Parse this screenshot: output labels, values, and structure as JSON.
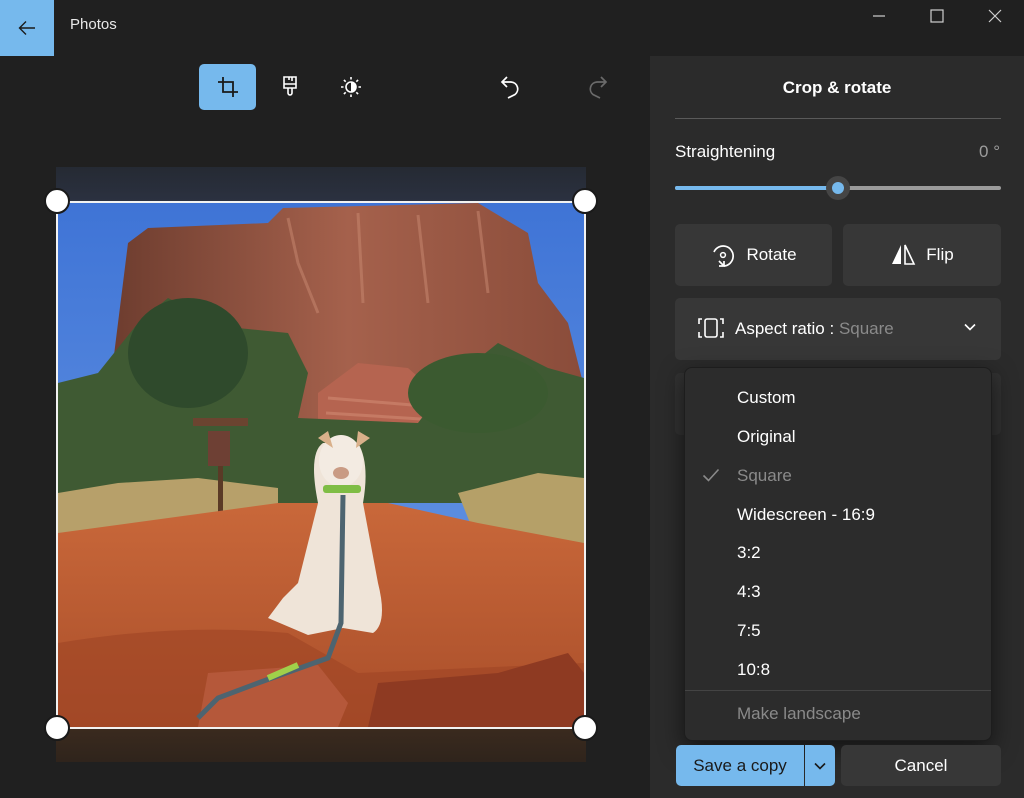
{
  "app": {
    "title": "Photos",
    "back_icon": "arrow-left-icon",
    "window_controls": [
      "minimize-icon",
      "maximize-icon",
      "close-icon"
    ]
  },
  "toolbar": {
    "tools": [
      {
        "name": "crop",
        "icon": "crop-icon",
        "active": true
      },
      {
        "name": "markup",
        "icon": "brush-icon",
        "active": false
      },
      {
        "name": "adjust",
        "icon": "brightness-icon",
        "active": false
      }
    ],
    "undo_icon": "undo-icon",
    "redo_icon": "redo-icon",
    "redo_enabled": false
  },
  "canvas": {
    "image_description": "White dog sitting on red dirt trail in front of red rock butte under blue sky",
    "crop_aspect": "Square"
  },
  "panel": {
    "title": "Crop & rotate",
    "straightening": {
      "label": "Straightening",
      "value_text": "0 °",
      "value_deg": 0,
      "fraction": 0.5
    },
    "rotate_label": "Rotate",
    "flip_label": "Flip",
    "aspect": {
      "label": "Aspect ratio : ",
      "value": "Square"
    }
  },
  "aspect_dropdown": {
    "items": [
      {
        "label": "Custom",
        "selected": false
      },
      {
        "label": "Original",
        "selected": false
      },
      {
        "label": "Square",
        "selected": true
      },
      {
        "label": "Widescreen - 16:9",
        "selected": false
      },
      {
        "label": "3:2",
        "selected": false
      },
      {
        "label": "4:3",
        "selected": false
      },
      {
        "label": "7:5",
        "selected": false
      },
      {
        "label": "10:8",
        "selected": false
      }
    ],
    "footer_item": {
      "label": "Make landscape",
      "disabled": true
    }
  },
  "actions": {
    "save_label": "Save a copy",
    "cancel_label": "Cancel"
  },
  "colors": {
    "accent": "#76b9ed",
    "background": "#202020",
    "panel": "#2b2b2b",
    "button": "#373737"
  }
}
